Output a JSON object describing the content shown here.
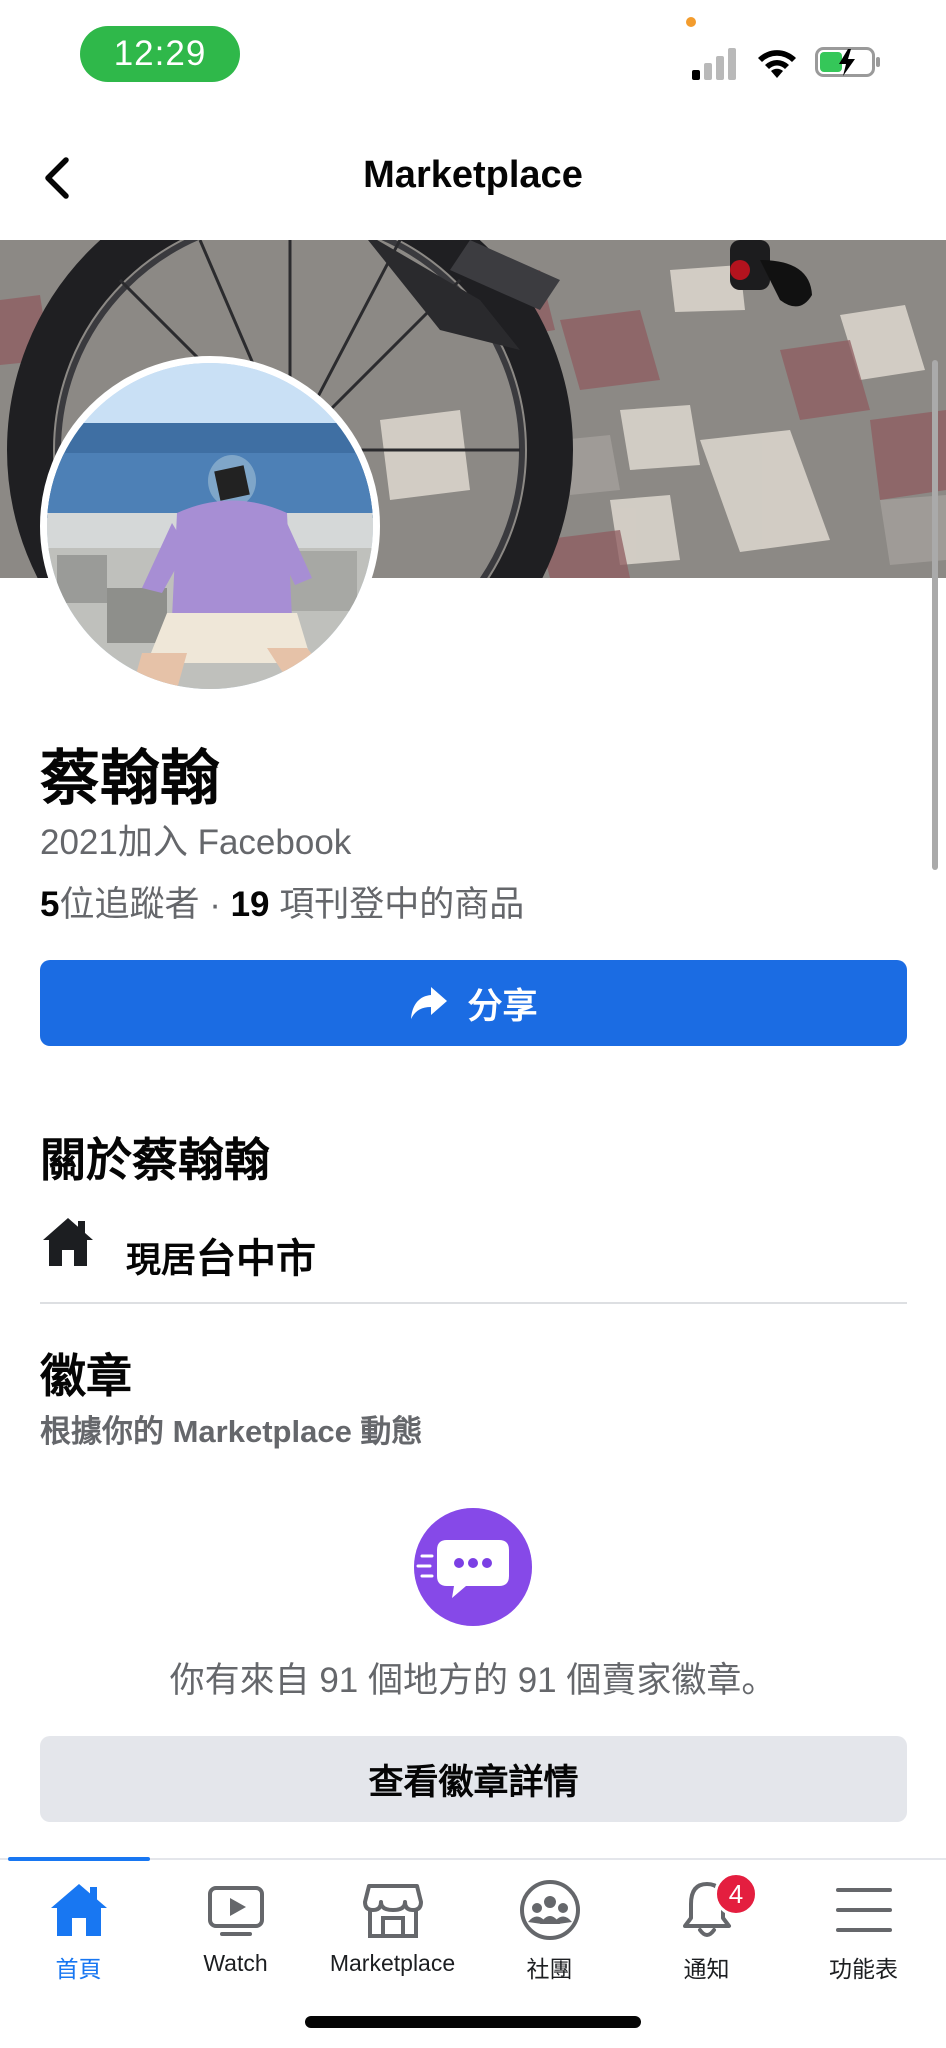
{
  "status_bar": {
    "time": "12:29",
    "icons": [
      "signal-icon",
      "wifi-icon",
      "battery-charging-icon"
    ]
  },
  "header": {
    "title": "Marketplace",
    "back_icon": "chevron-left-icon"
  },
  "profile": {
    "name": "蔡翰翰",
    "joined": "2021加入 Facebook",
    "followers_count": "5",
    "followers_label": "位追蹤者",
    "separator": " · ",
    "listings_count": "19",
    "listings_label": " 項刊登中的商品"
  },
  "share_button": {
    "label": "分享",
    "icon": "share-arrow-icon"
  },
  "about": {
    "title": "關於蔡翰翰",
    "location_prefix": "現居",
    "location_city": "台中市",
    "icon": "home-icon"
  },
  "badges": {
    "title": "徽章",
    "subtitle": "根據你的 Marketplace 動態",
    "summary": "你有來自 91 個地方的 91 個賣家徽章。",
    "details_button": "查看徽章詳情",
    "icon": "chat-badge-icon"
  },
  "tab_bar": {
    "tabs": [
      {
        "label": "首頁",
        "icon": "home-icon",
        "active": true
      },
      {
        "label": "Watch",
        "icon": "watch-icon",
        "active": false
      },
      {
        "label": "Marketplace",
        "icon": "marketplace-icon",
        "active": false
      },
      {
        "label": "社團",
        "icon": "groups-icon",
        "active": false
      },
      {
        "label": "通知",
        "icon": "bell-icon",
        "active": false,
        "badge": "4"
      },
      {
        "label": "功能表",
        "icon": "menu-icon",
        "active": false
      }
    ]
  },
  "colors": {
    "accent": "#1877f2",
    "share_button": "#1b6ce3",
    "badge_purple": "#7b3fe4",
    "notification_red": "#e41e3f",
    "time_pill": "#2fb84a"
  }
}
